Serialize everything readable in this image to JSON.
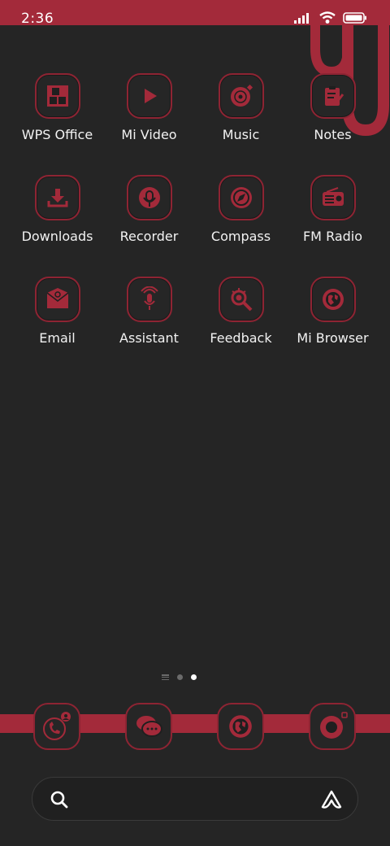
{
  "status": {
    "time": "2:36"
  },
  "apps": [
    {
      "label": "WPS Office",
      "icon": "wps-office-icon"
    },
    {
      "label": "Mi Video",
      "icon": "play-icon"
    },
    {
      "label": "Music",
      "icon": "vinyl-disc-icon"
    },
    {
      "label": "Notes",
      "icon": "clipboard-note-icon"
    },
    {
      "label": "Downloads",
      "icon": "download-tray-icon"
    },
    {
      "label": "Recorder",
      "icon": "microphone-icon"
    },
    {
      "label": "Compass",
      "icon": "compass-icon"
    },
    {
      "label": "FM Radio",
      "icon": "radio-icon"
    },
    {
      "label": "Email",
      "icon": "envelope-at-icon"
    },
    {
      "label": "Assistant",
      "icon": "assistant-mic-icon"
    },
    {
      "label": "Feedback",
      "icon": "bug-magnifier-icon"
    },
    {
      "label": "Mi Browser",
      "icon": "globe-icon"
    }
  ],
  "dock": [
    {
      "icon": "phone-contact-icon"
    },
    {
      "icon": "chat-bubbles-icon"
    },
    {
      "icon": "globe-icon"
    },
    {
      "icon": "camera-lens-icon"
    }
  ],
  "pager": {
    "pages": 2,
    "current": 2
  },
  "theme": {
    "accent": "#a32a3a",
    "background": "#252525"
  }
}
